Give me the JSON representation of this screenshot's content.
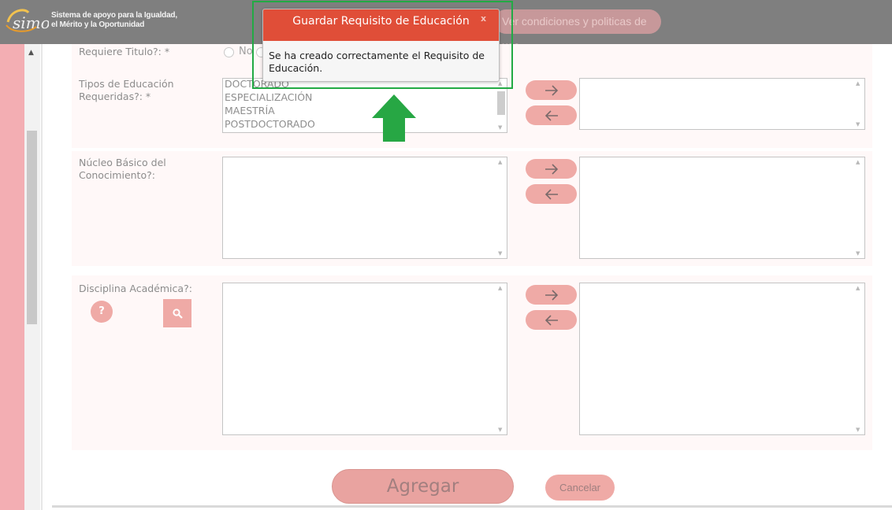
{
  "header": {
    "logo_text": "simo",
    "brand_line_1": "Sistema de apoyo para la Igualdad,",
    "brand_line_2": "el Mérito y la Oportunidad",
    "terms_button": "Ver condiciones y politicas de uso"
  },
  "form": {
    "requiere_titulo": {
      "label": "Requiere Titulo?:  *",
      "option_no": "No"
    },
    "tipos_educacion": {
      "label_line_1": "Tipos de Educación",
      "label_line_2": "Requeridas?:  *",
      "options": [
        "DOCTORADO",
        "ESPECIALIZACIÓN",
        "MAESTRÍA",
        "POSTDOCTORADO"
      ]
    },
    "nucleo_basico": {
      "label_line_1": "Núcleo Básico del",
      "label_line_2": "Conocimiento?:"
    },
    "disciplina": {
      "label": "Disciplina Académica?:",
      "help_button": "?"
    },
    "add_button": "Agregar",
    "cancel_button": "Cancelar"
  },
  "modal": {
    "title": "Guardar Requisito de Educación",
    "close": "x",
    "message": "Se ha creado correctamente el Requisito de Educación."
  },
  "colors": {
    "header_bg": "#7f7f7f",
    "modal_header": "#e04e38",
    "button_pink": "#efaaa6",
    "highlight_green": "#22aa44"
  }
}
